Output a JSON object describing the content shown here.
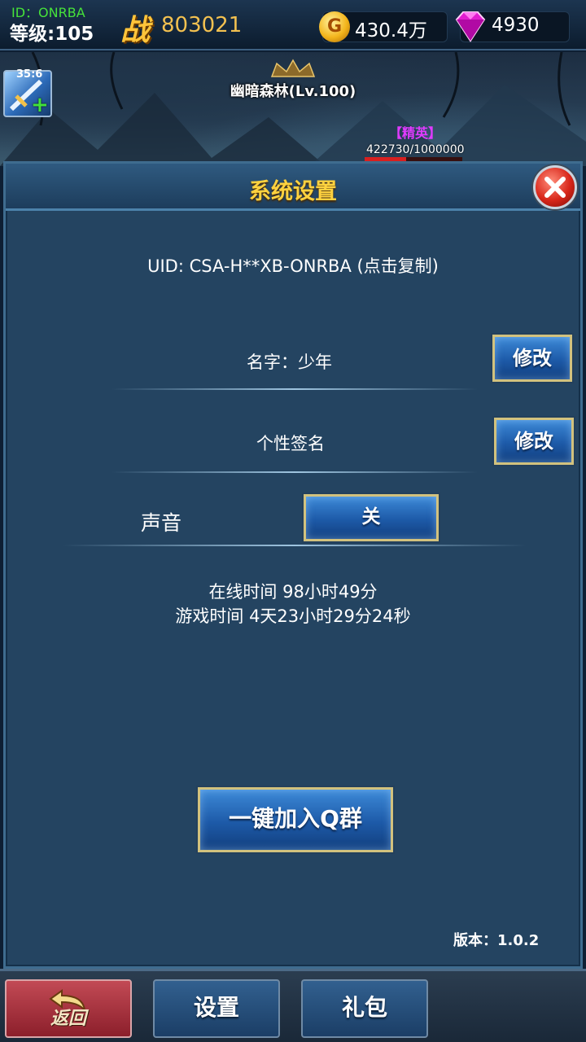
{
  "player": {
    "id_text": "ID：ONRBA",
    "level_text": "等级:105",
    "power_glyph": "战",
    "power_value": "803021",
    "gold_icon": "G",
    "gold_value": "430.4万",
    "gem_value": "4930"
  },
  "scene": {
    "skill_timer": "35:6",
    "skill_plus": "+",
    "stage_title": "幽暗森林(Lv.100)",
    "elite_tag": "【精英】",
    "boss_hp_text": "422730/1000000",
    "boss_hp_fraction": 0.42273
  },
  "settings": {
    "title": "系统设置",
    "uid_text": "UID: CSA-H**XB-ONRBA (点击复制)",
    "name_label": "名字：少年",
    "edit_name_label": "修改",
    "signature_label": "个性签名",
    "edit_signature_label": "修改",
    "sound_label": "声音",
    "sound_toggle_label": "关",
    "online_time": "在线时间 98小时49分",
    "game_time": "游戏时间 4天23小时29分24秒",
    "join_qq_label": "一键加入Q群",
    "version_text": "版本：1.0.2"
  },
  "nav": {
    "back_label": "返回",
    "settings_label": "设置",
    "gift_label": "礼包"
  },
  "colors": {
    "title_gold": "#ffd23f",
    "id_green": "#46e23a",
    "elite_purple": "#e03bff",
    "panel_blue": "#244461"
  },
  "icons": [
    "gold-coin-icon",
    "gem-icon",
    "sword-skill-icon",
    "close-icon",
    "back-arrow-icon"
  ]
}
